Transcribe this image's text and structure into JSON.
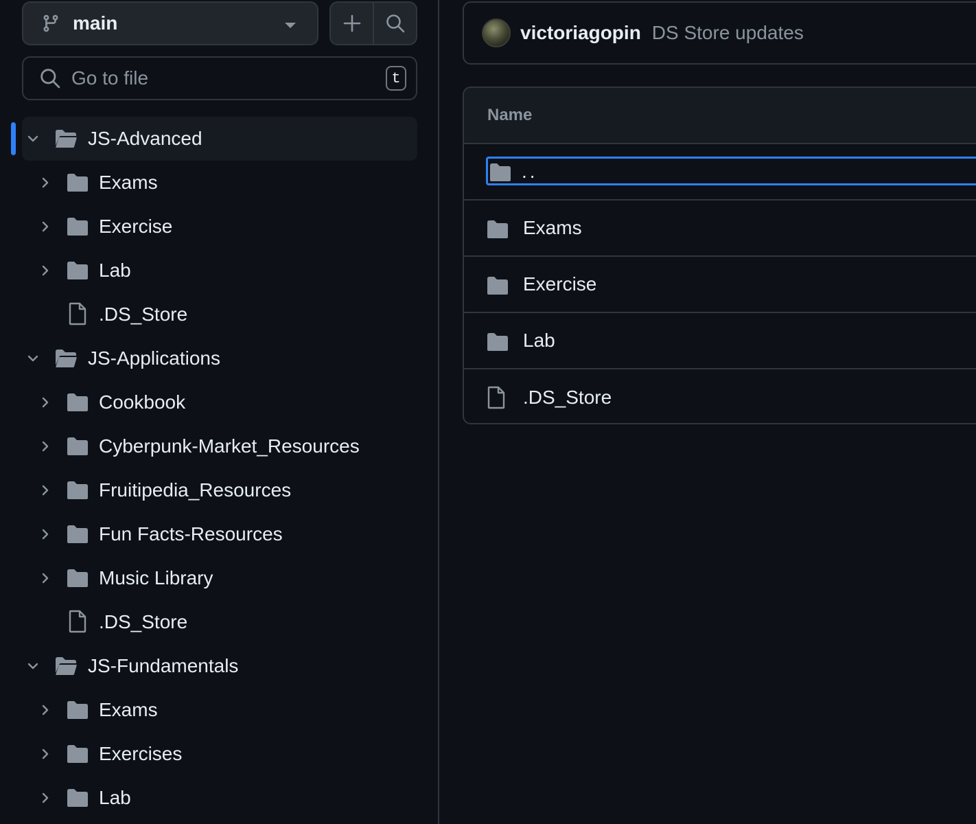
{
  "sidebar": {
    "branch": {
      "name": "main"
    },
    "search": {
      "placeholder": "Go to file",
      "shortcut": "t"
    },
    "tree": [
      {
        "label": "JS-Advanced",
        "level": 0,
        "type": "dir-open",
        "active": true
      },
      {
        "label": "Exams",
        "level": 1,
        "type": "dir"
      },
      {
        "label": "Exercise",
        "level": 1,
        "type": "dir"
      },
      {
        "label": "Lab",
        "level": 1,
        "type": "dir"
      },
      {
        "label": ".DS_Store",
        "level": 1,
        "type": "file"
      },
      {
        "label": "JS-Applications",
        "level": 0,
        "type": "dir-open"
      },
      {
        "label": "Cookbook",
        "level": 1,
        "type": "dir"
      },
      {
        "label": "Cyberpunk-Market_Resources",
        "level": 1,
        "type": "dir"
      },
      {
        "label": "Fruitipedia_Resources",
        "level": 1,
        "type": "dir"
      },
      {
        "label": "Fun Facts-Resources",
        "level": 1,
        "type": "dir"
      },
      {
        "label": "Music Library",
        "level": 1,
        "type": "dir"
      },
      {
        "label": ".DS_Store",
        "level": 1,
        "type": "file"
      },
      {
        "label": "JS-Fundamentals",
        "level": 0,
        "type": "dir-open"
      },
      {
        "label": "Exams",
        "level": 1,
        "type": "dir"
      },
      {
        "label": "Exercises",
        "level": 1,
        "type": "dir"
      },
      {
        "label": "Lab",
        "level": 1,
        "type": "dir"
      }
    ]
  },
  "commit": {
    "author": "victoriagopin",
    "message": "DS Store updates"
  },
  "table": {
    "header": "Name",
    "rows": [
      {
        "label": "..",
        "type": "parent",
        "focused": true
      },
      {
        "label": "Exams",
        "type": "dir"
      },
      {
        "label": "Exercise",
        "type": "dir"
      },
      {
        "label": "Lab",
        "type": "dir"
      },
      {
        "label": ".DS_Store",
        "type": "file"
      }
    ]
  },
  "colors": {
    "accent": "#2f81f7",
    "background": "#0d1117",
    "border": "#30363d",
    "muted": "#8b949e"
  },
  "icons": [
    "git-branch-icon",
    "triangle-down-icon",
    "plus-icon",
    "search-icon",
    "chevron-down-icon",
    "chevron-right-icon",
    "file-directory-open-icon",
    "file-directory-icon",
    "file-icon"
  ]
}
